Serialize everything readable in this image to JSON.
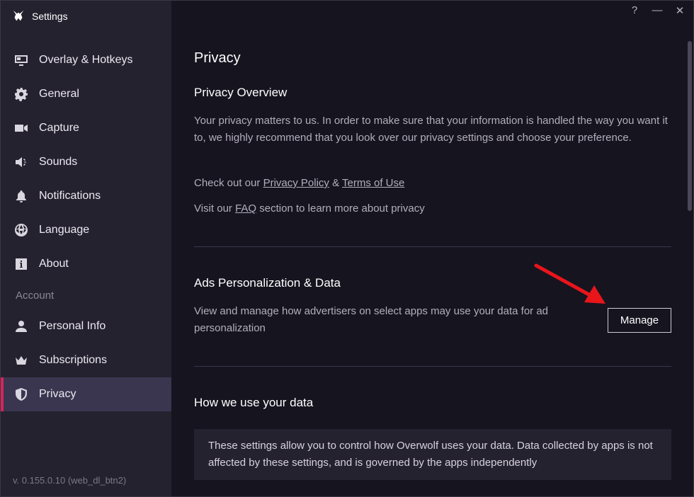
{
  "app": {
    "title": "Settings"
  },
  "window_controls": {
    "help": "?",
    "minimize": "—",
    "close": "✕"
  },
  "sidebar": {
    "items": [
      {
        "label": "Overlay & Hotkeys",
        "icon": "overlay-icon"
      },
      {
        "label": "General",
        "icon": "gear-icon"
      },
      {
        "label": "Capture",
        "icon": "video-camera-icon"
      },
      {
        "label": "Sounds",
        "icon": "speaker-icon"
      },
      {
        "label": "Notifications",
        "icon": "bell-icon"
      },
      {
        "label": "Language",
        "icon": "globe-icon"
      },
      {
        "label": "About",
        "icon": "info-icon"
      }
    ],
    "section_account": "Account",
    "account_items": [
      {
        "label": "Personal Info",
        "icon": "person-icon"
      },
      {
        "label": "Subscriptions",
        "icon": "crown-icon"
      },
      {
        "label": "Privacy",
        "icon": "shield-icon",
        "active": true
      }
    ],
    "version": "v. 0.155.0.10 (web_dl_btn2)"
  },
  "main": {
    "title": "Privacy",
    "overview": {
      "heading": "Privacy Overview",
      "text": "Your privacy matters to us. In order to make sure that your information is handled the way you want it to, we highly recommend that you look over our privacy settings and choose your preference.",
      "links_prefix": "Check out our ",
      "privacy_policy": "Privacy Policy",
      "amp": " & ",
      "terms": "Terms of Use",
      "faq_prefix": "Visit our ",
      "faq": "FAQ",
      "faq_suffix": " section to learn more about privacy"
    },
    "ads": {
      "heading": "Ads Personalization & Data",
      "text": "View and manage how advertisers on select apps may use your data for ad personalization",
      "button": "Manage"
    },
    "usage": {
      "heading": "How we use your data",
      "info": "These settings allow you to control how Overwolf uses your data. Data collected by apps is not affected by these settings, and is governed by the apps independently"
    }
  },
  "colors": {
    "accent": "#d3265c",
    "arrow": "#e8151b",
    "sidebar_bg": "#25222f",
    "main_bg": "#16141f"
  }
}
